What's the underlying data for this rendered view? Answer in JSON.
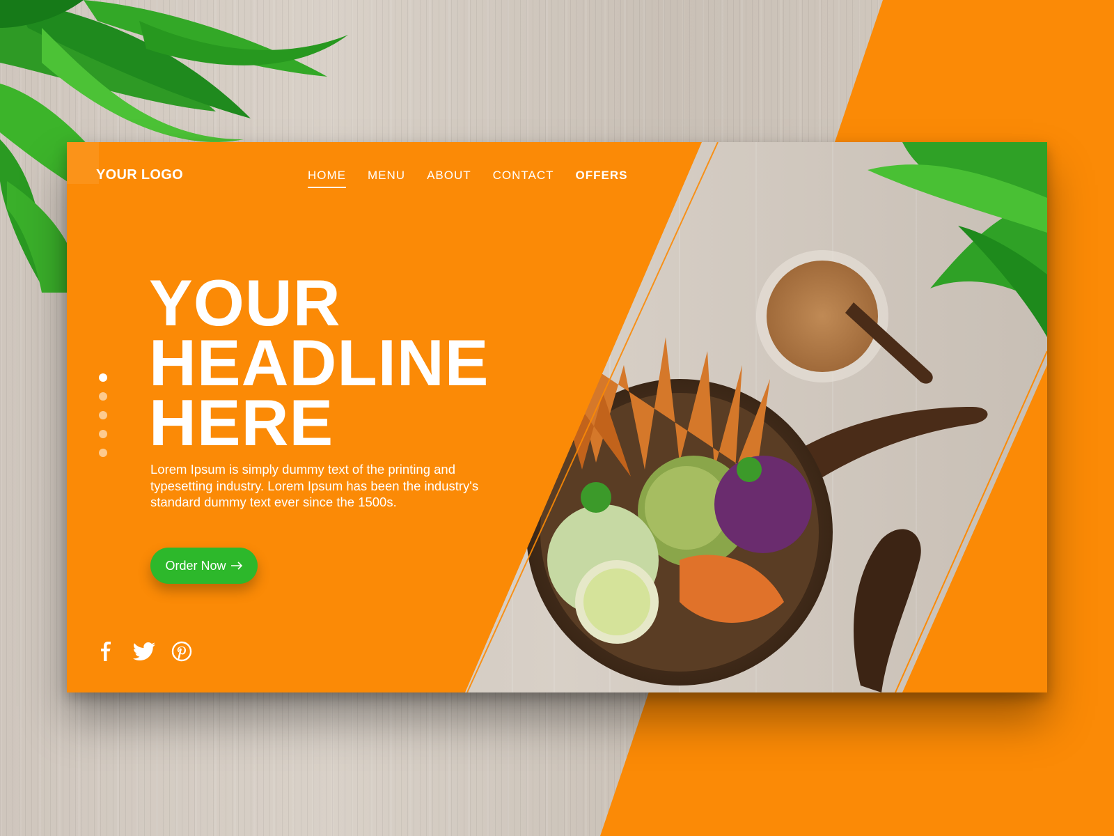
{
  "brand": {
    "logo": "YOUR LOGO"
  },
  "nav": {
    "items": [
      {
        "label": "HOME",
        "active": true
      },
      {
        "label": "MENU"
      },
      {
        "label": "ABOUT"
      },
      {
        "label": "CONTACT"
      },
      {
        "label": "OFFERS"
      }
    ]
  },
  "hero": {
    "headline_lines": [
      "YOUR",
      "HEADLINE",
      "HERE"
    ],
    "body": "Lorem Ipsum is simply dummy text of the printing and typesetting industry. Lorem Ipsum has been the industry's standard dummy text ever since the 1500s.",
    "cta_label": "Order Now",
    "cta_icon": "arrow-right-icon"
  },
  "slider": {
    "dot_count": 5,
    "active_index": 0
  },
  "socials": [
    "facebook-icon",
    "twitter-icon",
    "pinterest-icon"
  ],
  "colors": {
    "orange": "#fb8a06",
    "green": "#2db82b",
    "white": "#ffffff"
  }
}
